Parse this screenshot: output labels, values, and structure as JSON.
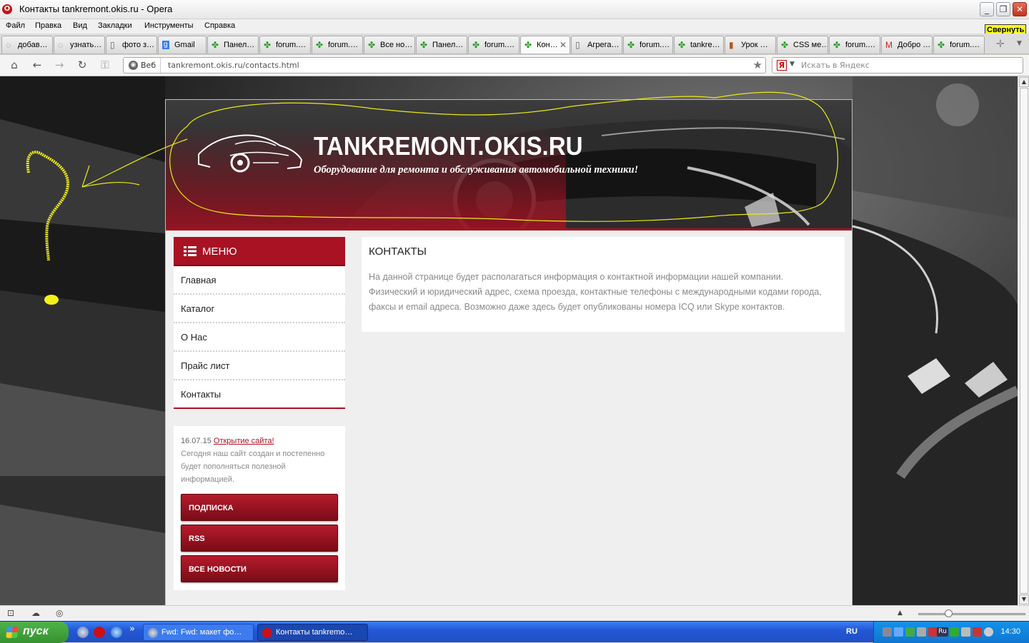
{
  "window": {
    "title": "Контакты tankremont.okis.ru - Opera",
    "minimize_tooltip": "Свернуть"
  },
  "menubar": [
    "Файл",
    "Правка",
    "Вид",
    "Закладки",
    "Инструменты",
    "Справка"
  ],
  "tabs": [
    {
      "label": "добав…",
      "icon": "loading-icon"
    },
    {
      "label": "узнать…",
      "icon": "loading-icon"
    },
    {
      "label": "фото з…",
      "icon": "page-icon"
    },
    {
      "label": "Gmail",
      "icon": "google-icon"
    },
    {
      "label": "Панел…",
      "icon": "puzzle-icon"
    },
    {
      "label": "forum.…",
      "icon": "puzzle-icon"
    },
    {
      "label": "forum.…",
      "icon": "puzzle-icon"
    },
    {
      "label": "Все но…",
      "icon": "puzzle-icon"
    },
    {
      "label": "Панел…",
      "icon": "puzzle-icon"
    },
    {
      "label": "forum.…",
      "icon": "puzzle-icon"
    },
    {
      "label": "Кон…",
      "icon": "puzzle-icon",
      "active": true
    },
    {
      "label": "Агрега…",
      "icon": "page-icon"
    },
    {
      "label": "forum.…",
      "icon": "puzzle-icon"
    },
    {
      "label": "tankre…",
      "icon": "puzzle-icon"
    },
    {
      "label": "Урок …",
      "icon": "bars-icon"
    },
    {
      "label": "CSS ме…",
      "icon": "puzzle-icon"
    },
    {
      "label": "forum.…",
      "icon": "puzzle-icon"
    },
    {
      "label": "Добро …",
      "icon": "gmail-icon"
    },
    {
      "label": "forum.…",
      "icon": "puzzle-icon"
    }
  ],
  "navbar": {
    "web_label": "Веб",
    "url": "tankremont.okis.ru/contacts.html",
    "search_placeholder": "Искать в Яндекс",
    "search_engine_letter": "Я"
  },
  "site": {
    "name": "TANKREMONT.OKIS.RU",
    "slogan": "Оборудование для ремонта и обслуживания автомобильной техники!",
    "menu_title": "МЕНЮ",
    "menu_items": [
      "Главная",
      "Каталог",
      "О Нас",
      "Прайс лист",
      "Контакты"
    ],
    "news": {
      "date": "16.07.15",
      "link": "Открытие сайта!",
      "text": "Сегодня наш сайт создан и постепенно будет пополняться полезной информацией."
    },
    "buttons": [
      "ПОДПИСКА",
      "RSS",
      "ВСЕ НОВОСТИ"
    ],
    "content": {
      "heading": "КОНТАКТЫ",
      "body": "На данной странице будет располагаться информация о контактной информации нашей компании. Физический и юридический адрес, схема проезда, контактные телефоны с международными кодами города, факсы и email адреса. Возможно даже здесь будет опубликованы номера ICQ или Skype контактов."
    },
    "annotation_color": "#f2f21a",
    "accent_color": "#a81223"
  },
  "taskbar": {
    "start_label": "пуск",
    "more": "»",
    "tasks": [
      "Fwd: Fwd: макет фо…",
      "Контакты tankremo…"
    ],
    "language": "RU",
    "tray_lang": "Ru",
    "clock": "14:30"
  }
}
